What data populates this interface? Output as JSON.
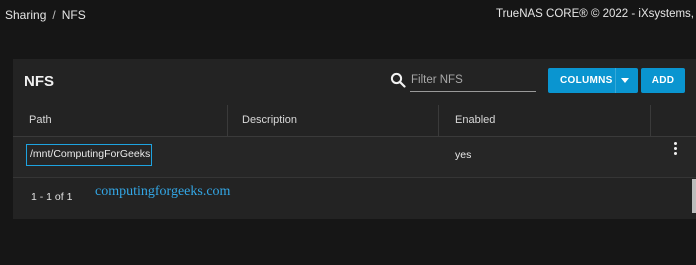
{
  "breadcrumb": {
    "items": [
      "Sharing",
      "NFS"
    ],
    "separator": "/"
  },
  "copyright": "TrueNAS CORE® © 2022 - iXsystems,",
  "card": {
    "title": "NFS",
    "search": {
      "placeholder": "Filter NFS",
      "value": "",
      "icon": "search-icon"
    },
    "columns_label": "COLUMNS",
    "add_label": "ADD",
    "accent_color": "#0a95d0"
  },
  "table": {
    "headers": [
      "Path",
      "Description",
      "Enabled"
    ],
    "rows": [
      {
        "path": "/mnt/ComputingForGeeks",
        "description": "",
        "enabled": "yes"
      }
    ]
  },
  "pager": "1 - 1 of 1",
  "watermark": "computingforgeeks.com"
}
